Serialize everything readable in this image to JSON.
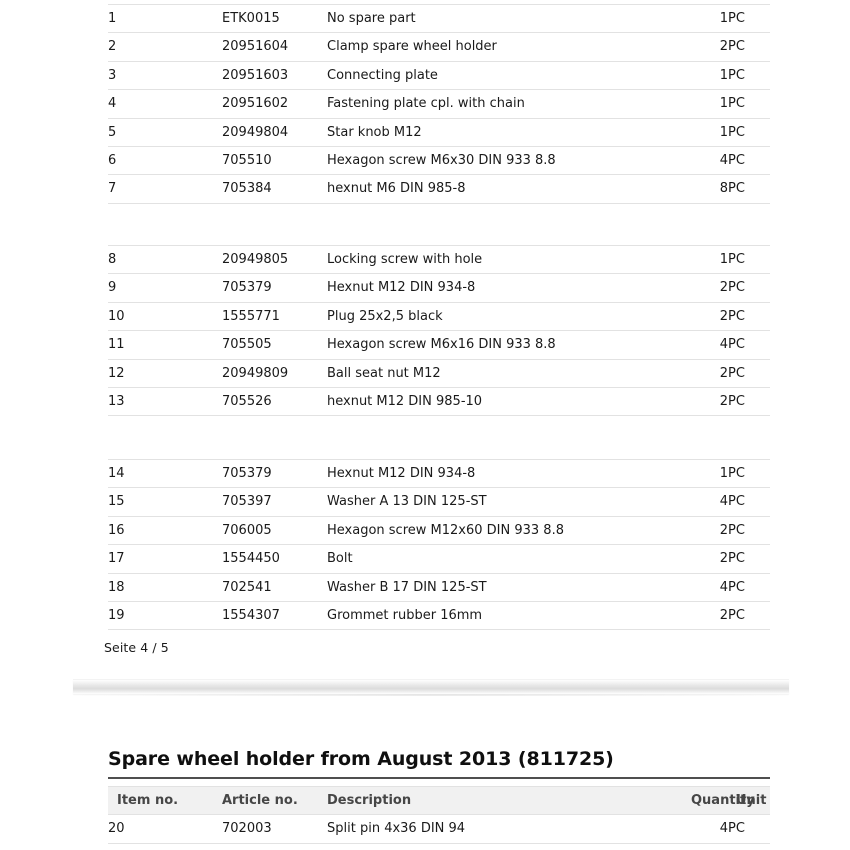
{
  "document": {
    "page_footer": "Seite 4 / 5"
  },
  "columns": {
    "item_no": "Item no.",
    "article_no": "Article no.",
    "description": "Description",
    "quantity": "Quantity",
    "unit": "Unit"
  },
  "blocks": [
    {
      "id": "block-1",
      "rows": [
        {
          "item": "1",
          "article": "ETK0015",
          "description": "No spare part",
          "quantity": "1",
          "unit": "PC"
        },
        {
          "item": "2",
          "article": "20951604",
          "description": "Clamp spare wheel holder",
          "quantity": "2",
          "unit": "PC"
        },
        {
          "item": "3",
          "article": "20951603",
          "description": "Connecting plate",
          "quantity": "1",
          "unit": "PC"
        },
        {
          "item": "4",
          "article": "20951602",
          "description": "Fastening plate cpl. with chain",
          "quantity": "1",
          "unit": "PC"
        },
        {
          "item": "5",
          "article": "20949804",
          "description": "Star knob M12",
          "quantity": "1",
          "unit": "PC"
        },
        {
          "item": "6",
          "article": "705510",
          "description": "Hexagon screw M6x30 DIN 933 8.8",
          "quantity": "4",
          "unit": "PC"
        },
        {
          "item": "7",
          "article": "705384",
          "description": "hexnut M6 DIN 985-8",
          "quantity": "8",
          "unit": "PC"
        }
      ]
    },
    {
      "id": "block-2",
      "rows": [
        {
          "item": "8",
          "article": "20949805",
          "description": "Locking screw with hole",
          "quantity": "1",
          "unit": "PC"
        },
        {
          "item": "9",
          "article": "705379",
          "description": "Hexnut M12 DIN 934-8",
          "quantity": "2",
          "unit": "PC"
        },
        {
          "item": "10",
          "article": "1555771",
          "description": "Plug 25x2,5 black",
          "quantity": "2",
          "unit": "PC"
        },
        {
          "item": "11",
          "article": "705505",
          "description": "Hexagon screw M6x16 DIN 933 8.8",
          "quantity": "4",
          "unit": "PC"
        },
        {
          "item": "12",
          "article": "20949809",
          "description": "Ball seat nut M12",
          "quantity": "2",
          "unit": "PC"
        },
        {
          "item": "13",
          "article": "705526",
          "description": "hexnut M12 DIN 985-10",
          "quantity": "2",
          "unit": "PC"
        }
      ]
    },
    {
      "id": "block-3",
      "rows": [
        {
          "item": "14",
          "article": "705379",
          "description": "Hexnut M12 DIN 934-8",
          "quantity": "1",
          "unit": "PC"
        },
        {
          "item": "15",
          "article": "705397",
          "description": "Washer A 13 DIN 125-ST",
          "quantity": "4",
          "unit": "PC"
        },
        {
          "item": "16",
          "article": "706005",
          "description": "Hexagon screw M12x60 DIN 933 8.8",
          "quantity": "2",
          "unit": "PC"
        },
        {
          "item": "17",
          "article": "1554450",
          "description": "Bolt",
          "quantity": "2",
          "unit": "PC"
        },
        {
          "item": "18",
          "article": "702541",
          "description": "Washer B 17 DIN 125-ST",
          "quantity": "4",
          "unit": "PC"
        },
        {
          "item": "19",
          "article": "1554307",
          "description": "Grommet rubber 16mm",
          "quantity": "2",
          "unit": "PC"
        }
      ]
    },
    {
      "id": "block-4",
      "heading": "Spare wheel holder from August 2013 (811725)",
      "has_header_row": true,
      "rows": [
        {
          "item": "20",
          "article": "702003",
          "description": "Split pin 4x36 DIN 94",
          "quantity": "4",
          "unit": "PC"
        }
      ]
    }
  ],
  "colors": {
    "text": "#1a1a1a",
    "header_text": "#464646",
    "header_background": "#f1f1f1",
    "row_border": "#e2e2e2",
    "heading_rule": "#4f4f4f"
  }
}
